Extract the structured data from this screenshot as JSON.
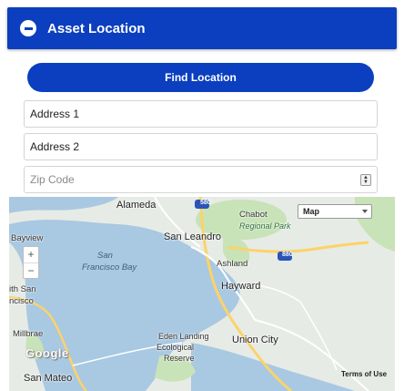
{
  "header": {
    "title": "Asset Location",
    "collapse_icon": "minus-circle-icon"
  },
  "actions": {
    "find_location_label": "Find Location"
  },
  "form": {
    "address1_value": "Address 1",
    "address2_value": "Address 2",
    "zip_placeholder": "Zip Code"
  },
  "map": {
    "type_selected": "Map",
    "terms_label": "Terms of Use",
    "logo_text": "Google",
    "highway_labels": [
      "580",
      "880"
    ],
    "places": {
      "alameda": "Alameda",
      "chabot": "Chabot",
      "regional_park": "Regional Park",
      "san_leandro": "San Leandro",
      "bayview": "Bayview",
      "san": "San",
      "francisco_bay": "Francisco Bay",
      "ashland": "Ashland",
      "hayward": "Hayward",
      "south_san": "ith San",
      "ncisco": "ncisco",
      "millbrae": "Millbrae",
      "san_mateo": "San Mateo",
      "eden_landing": "Eden Landing",
      "ecological": "Ecological",
      "reserve": "Reserve",
      "union_city": "Union City"
    },
    "colors": {
      "water": "#a9c8e2",
      "land": "#e7ebe6",
      "park": "#c8e3b7",
      "highway": "#fbd36a",
      "accent": "#0b3fbf"
    }
  }
}
